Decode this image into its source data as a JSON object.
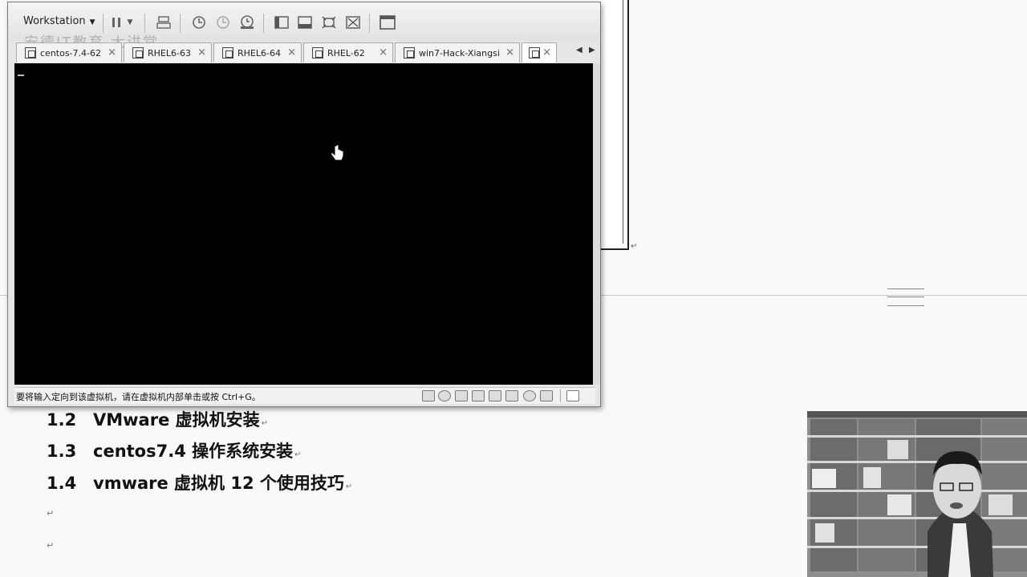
{
  "vmware": {
    "menu_label": "Workstation",
    "watermark": "安德IT教育 大讲堂",
    "tabs": [
      {
        "label": "centos-7.4-62"
      },
      {
        "label": "RHEL6-63"
      },
      {
        "label": "RHEL6-64"
      },
      {
        "label": "RHEL-62"
      },
      {
        "label": "win7-Hack-Xiangsi"
      }
    ],
    "tab_close": "×",
    "tab_prev": "◀",
    "tab_next": "▶",
    "status_text": "要将输入定向到该虚拟机，请在虚拟机内部单击或按 Ctrl+G。",
    "toolbar_icons": [
      "menu-dropdown",
      "pause-icon",
      "dropdown-icon",
      "send-ctrl-alt-del-icon",
      "snapshot-icon",
      "revert-snapshot-icon",
      "snapshot-manager-icon",
      "sidebar-toggle-icon",
      "thumbnail-bar-icon",
      "fullscreen-icon",
      "unity-icon",
      "console-view-icon"
    ]
  },
  "document": {
    "toc": [
      {
        "num": "1.2",
        "title": "VMware 虚拟机安装"
      },
      {
        "num": "1.3",
        "title": "centos7.4 操作系统安装"
      },
      {
        "num": "1.4",
        "title": "vmware 虚拟机 12 个使用技巧"
      }
    ],
    "para_mark": "↵"
  }
}
